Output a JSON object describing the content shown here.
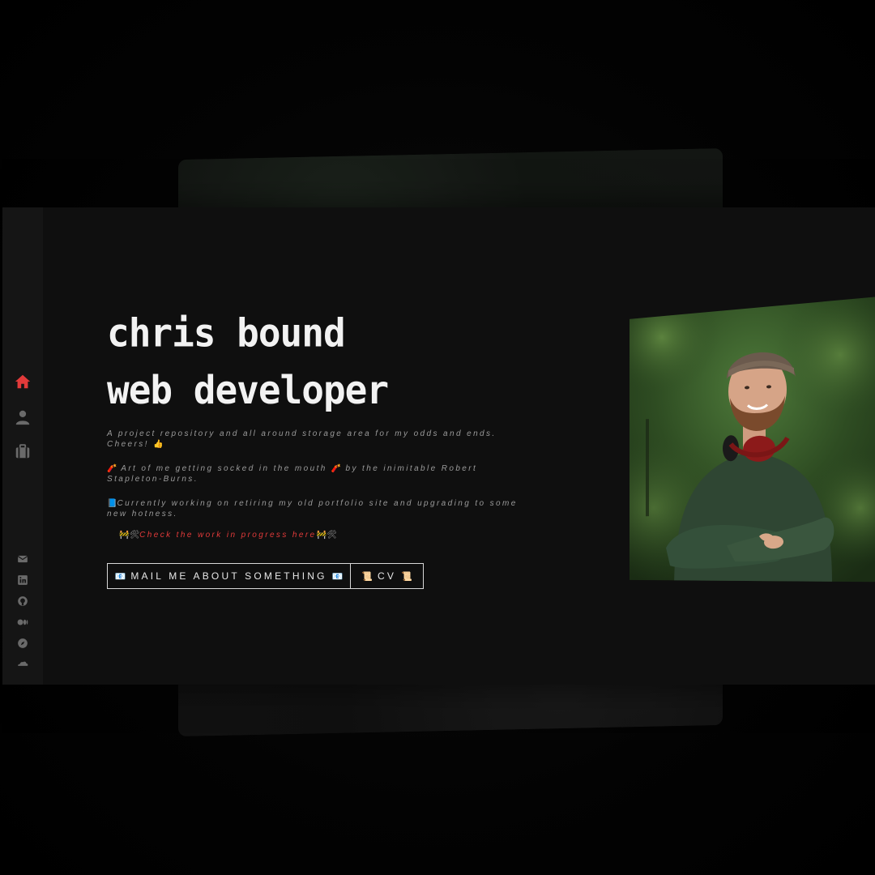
{
  "header": {
    "name": "chris bound",
    "role": "web developer"
  },
  "intro": {
    "p1": "A project repository and all around storage area for my odds and ends. Cheers! ",
    "p1_emoji": "👍",
    "p2_emoji_a": "🧨",
    "p2": " Art of me getting socked in the mouth ",
    "p2_emoji_b": "🧨",
    "p2_tail": " by the inimitable Robert Stapleton-Burns.",
    "p3_emoji": "📘",
    "p3": "Currently working on retiring my old portfolio site and upgrading to some new hotness.",
    "p4_emoji_a": "🚧🛠",
    "p4_link": "Check the work in progress here",
    "p4_emoji_b": "🚧🛠"
  },
  "buttons": {
    "mail_emoji": "📧",
    "mail_label": "MAIL ME ABOUT SOMETHING",
    "cv_emoji": "📜",
    "cv_label": "CV"
  },
  "sidebar": {
    "nav": [
      {
        "icon": "home-icon",
        "active": true
      },
      {
        "icon": "user-icon",
        "active": false
      },
      {
        "icon": "briefcase-icon",
        "active": false
      }
    ],
    "social": [
      {
        "icon": "mail-icon"
      },
      {
        "icon": "linkedin-icon"
      },
      {
        "icon": "github-icon"
      },
      {
        "icon": "medium-icon"
      },
      {
        "icon": "compass-icon"
      },
      {
        "icon": "soundcloud-icon"
      }
    ]
  },
  "colors": {
    "accent": "#e23a3a",
    "background": "#0f0f0f",
    "sidebar": "#151515",
    "text": "#f2f2f2",
    "muted": "#9a9a9a"
  }
}
